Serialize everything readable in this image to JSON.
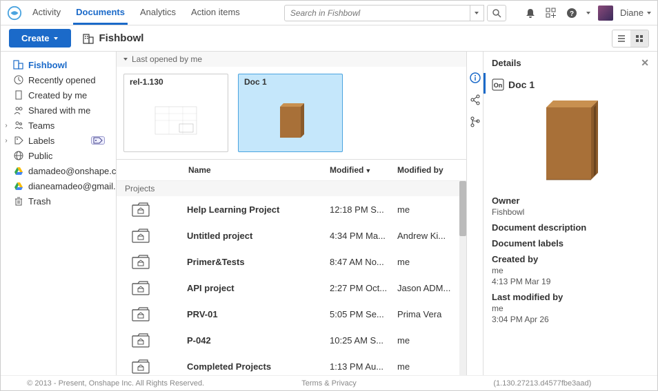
{
  "nav": {
    "tabs": [
      "Activity",
      "Documents",
      "Analytics",
      "Action items"
    ],
    "active_index": 1,
    "search_placeholder": "Search in Fishbowl",
    "username": "Diane"
  },
  "toolbar": {
    "create_label": "Create",
    "workspace": "Fishbowl"
  },
  "sidebar": {
    "items": [
      {
        "label": "Fishbowl",
        "icon": "building",
        "bold": true
      },
      {
        "label": "Recently opened",
        "icon": "clock"
      },
      {
        "label": "Created by me",
        "icon": "doc"
      },
      {
        "label": "Shared with me",
        "icon": "people"
      },
      {
        "label": "Teams",
        "icon": "teams",
        "expandable": true
      },
      {
        "label": "Labels",
        "icon": "labels",
        "expandable": true,
        "badge": true
      },
      {
        "label": "Public",
        "icon": "globe"
      },
      {
        "label": "damadeo@onshape.com",
        "icon": "gdrive"
      },
      {
        "label": "dianeamadeo@gmail.c...",
        "icon": "gdrive"
      },
      {
        "label": "Trash",
        "icon": "trash"
      }
    ]
  },
  "content": {
    "recent_header": "Last opened by me",
    "cards": [
      {
        "title": "rel-1.130",
        "thumb": "drawing"
      },
      {
        "title": "Doc 1",
        "thumb": "box3d",
        "selected": true
      }
    ],
    "table": {
      "columns": {
        "name": "Name",
        "modified": "Modified",
        "modified_by": "Modified by"
      },
      "group": "Projects",
      "rows": [
        {
          "name": "Help Learning Project",
          "modified": "12:18 PM S...",
          "modified_by": "me"
        },
        {
          "name": "Untitled project",
          "modified": "4:34 PM Ma...",
          "modified_by": "Andrew Ki..."
        },
        {
          "name": "Primer&Tests",
          "modified": "8:47 AM No...",
          "modified_by": "me"
        },
        {
          "name": "API project",
          "modified": "2:27 PM Oct...",
          "modified_by": "Jason ADM..."
        },
        {
          "name": "PRV-01",
          "modified": "5:05 PM Se...",
          "modified_by": "Prima Vera"
        },
        {
          "name": "P-042",
          "modified": "10:25 AM S...",
          "modified_by": "me"
        },
        {
          "name": "Completed Projects",
          "modified": "1:13 PM Au...",
          "modified_by": "me"
        }
      ]
    }
  },
  "details": {
    "header": "Details",
    "title": "Doc 1",
    "owner_label": "Owner",
    "owner": "Fishbowl",
    "description_label": "Document description",
    "labels_label": "Document labels",
    "created_by_label": "Created by",
    "created_by": "me",
    "created_at": "4:13 PM Mar 19",
    "modified_by_label": "Last modified by",
    "modified_by": "me",
    "modified_at": "3:04 PM Apr 26"
  },
  "footer": {
    "copyright": "© 2013 - Present, Onshape Inc. All Rights Reserved.",
    "terms": "Terms & Privacy",
    "version": "(1.130.27213.d4577fbe3aad)"
  }
}
